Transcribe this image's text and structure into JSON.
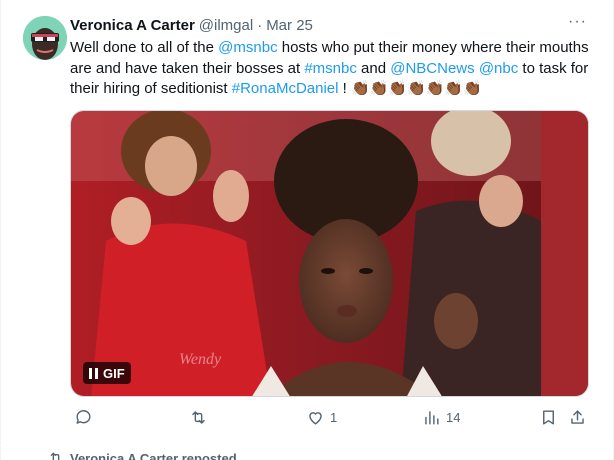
{
  "tweet": {
    "author_name": "Veronica A Carter",
    "handle": "@ilmgal",
    "separator": "·",
    "date": "Mar 25",
    "more_label": "···",
    "text": {
      "p1": "Well done to all of the ",
      "mention1": "@msnbc",
      "p2": " hosts who  put their money where their mouths are and have taken their bosses at ",
      "hashtag1": "#msnbc",
      "p3": " and ",
      "mention2": "@NBCNews",
      "p4": " ",
      "mention3": "@nbc",
      "p5": " to task for their hiring of seditionist ",
      "hashtag2": "#RonaMcDaniel",
      "p6": " ! ",
      "emoji": "👏🏾👏🏾👏🏾👏🏾👏🏾👏🏾👏🏾"
    },
    "media": {
      "badge_label": "GIF",
      "watermark": "Wendy"
    },
    "actions": {
      "reply_count": "",
      "repost_count": "",
      "like_count": "1",
      "views_count": "14"
    },
    "colors": {
      "link": "#1d9bf0",
      "secondary_text": "#536471",
      "avatar_bg": "#7fd3b6"
    }
  },
  "next_item": {
    "repost_label": "Veronica A Carter reposted"
  },
  "icons": [
    "reply-icon",
    "repost-icon",
    "like-icon",
    "views-icon",
    "bookmark-icon",
    "share-icon",
    "more-icon",
    "pause-icon"
  ]
}
